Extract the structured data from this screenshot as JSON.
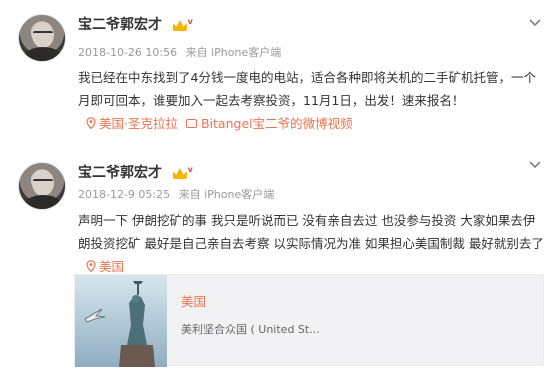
{
  "posts": [
    {
      "author": "宝二爷郭宏才",
      "date": "2018-10-26 10:56",
      "from": "来自 iPhone客户端",
      "text": "我已经在中东找到了4分钱一度电的电站，适合各种即将关机的二手矿机托管，一个月即可回本，谁要加入一起去考察投资，11月1日，出发！速来报名！",
      "location": "美国·圣克拉拉",
      "video_link": "Bitangel宝二爷的微博视频"
    },
    {
      "author": "宝二爷郭宏才",
      "date": "2018-12-9 05:25",
      "from": "来自 iPhone客户端",
      "text": "声明一下 伊朗挖矿的事 我只是听说而已 没有亲自去过 也没参与投资 大家如果去伊朗投资挖矿 最好是自己亲自去考察 以实际情况为准 如果担心美国制裁 最好就别去了",
      "location": "美国",
      "card": {
        "title": "美国",
        "subtitle": "美利坚合众国 ( United St..."
      }
    }
  ],
  "icons": {
    "badge": "vip-crown-icon",
    "menu": "chevron-down-icon",
    "location": "location-pin-icon",
    "video": "video-icon"
  },
  "colors": {
    "accent": "#eb7350",
    "meta_gray": "#9a9a9a",
    "card_bg": "#f2f2f5"
  }
}
